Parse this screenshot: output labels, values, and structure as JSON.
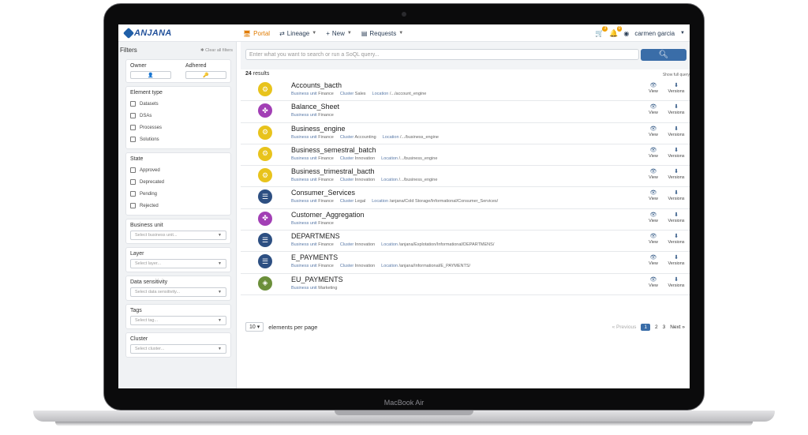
{
  "device": {
    "label": "MacBook Air"
  },
  "nav": {
    "logo_text": "ANJANA",
    "items": [
      {
        "label": "Portal",
        "icon": "monitor-icon",
        "active": true,
        "caret": false
      },
      {
        "label": "Lineage",
        "icon": "lineage-icon",
        "active": false,
        "caret": true
      },
      {
        "label": "New",
        "icon": "plus-icon",
        "active": false,
        "caret": true
      },
      {
        "label": "Requests",
        "icon": "requests-icon",
        "active": false,
        "caret": true
      }
    ],
    "cart_badge": "3",
    "bell_badge": "0",
    "user": "carmen garcia"
  },
  "sidebar": {
    "title": "Filters",
    "clear_label": "Clear all filters",
    "owner_label": "Owner",
    "adhered_label": "Adhered",
    "element_type": {
      "label": "Element type",
      "options": [
        "Datasets",
        "DSAs",
        "Processes",
        "Solutions"
      ]
    },
    "state": {
      "label": "State",
      "options": [
        "Approved",
        "Deprecated",
        "Pending",
        "Rejected"
      ]
    },
    "selects": [
      {
        "label": "Business unit",
        "placeholder": "Select business unit..."
      },
      {
        "label": "Layer",
        "placeholder": "Select layer..."
      },
      {
        "label": "Data sensitivity",
        "placeholder": "Select data sensitivity..."
      },
      {
        "label": "Tags",
        "placeholder": "Select tag..."
      },
      {
        "label": "Cluster",
        "placeholder": "Select cluster..."
      }
    ]
  },
  "search": {
    "placeholder": "Enter what you want to search or run a SoQL query...",
    "results_count": "24",
    "results_label": "results",
    "show_full_query": "Show full query"
  },
  "results": [
    {
      "name": "Accounts_bacth",
      "icon": "process-icon",
      "color": "#e8c31c",
      "meta": [
        [
          "Business unit",
          "Finance"
        ],
        [
          "Cluster",
          "Sales"
        ],
        [
          "Location",
          "/.../account_engine"
        ]
      ]
    },
    {
      "name": "Balance_Sheet",
      "icon": "dsa-icon",
      "color": "#a23fb5",
      "meta": [
        [
          "Business unit",
          "Finance"
        ]
      ]
    },
    {
      "name": "Business_engine",
      "icon": "process-icon",
      "color": "#e8c31c",
      "meta": [
        [
          "Business unit",
          "Finance"
        ],
        [
          "Cluster",
          "Accounting"
        ],
        [
          "Location",
          "/.../business_engine"
        ]
      ]
    },
    {
      "name": "Business_semestral_batch",
      "icon": "process-icon",
      "color": "#e8c31c",
      "meta": [
        [
          "Business unit",
          "Finance"
        ],
        [
          "Cluster",
          "Innovation"
        ],
        [
          "Location",
          "/.../business_engine"
        ]
      ]
    },
    {
      "name": "Business_trimestral_bacth",
      "icon": "process-icon",
      "color": "#e8c31c",
      "meta": [
        [
          "Business unit",
          "Finance"
        ],
        [
          "Cluster",
          "Innovation"
        ],
        [
          "Location",
          "/.../business_engine"
        ]
      ]
    },
    {
      "name": "Consumer_Services",
      "icon": "dataset-icon",
      "color": "#2d4f82",
      "meta": [
        [
          "Business unit",
          "Finance"
        ],
        [
          "Cluster",
          "Legal"
        ],
        [
          "Location",
          "/anjana/Cold Storage/Informational/Consumer_Services/"
        ]
      ]
    },
    {
      "name": "Customer_Aggregation",
      "icon": "dsa-icon",
      "color": "#a23fb5",
      "meta": [
        [
          "Business unit",
          "Finance"
        ]
      ]
    },
    {
      "name": "DEPARTMENS",
      "icon": "dataset-icon",
      "color": "#2d4f82",
      "meta": [
        [
          "Business unit",
          "Finance"
        ],
        [
          "Cluster",
          "Innovation"
        ],
        [
          "Location",
          "/anjana/Explotation/Informational/DEPARTMENS/"
        ]
      ]
    },
    {
      "name": "E_PAYMENTS",
      "icon": "dataset-icon",
      "color": "#2d4f82",
      "meta": [
        [
          "Business unit",
          "Finance"
        ],
        [
          "Cluster",
          "Innovation"
        ],
        [
          "Location",
          "/anjana/Informational/E_PAYMENTS/"
        ]
      ]
    },
    {
      "name": "EU_PAYMENTS",
      "icon": "solution-icon",
      "color": "#6b8f3a",
      "meta": [
        [
          "Business unit",
          "Marketing"
        ]
      ]
    }
  ],
  "row_actions": {
    "view": "View",
    "versions": "Versions"
  },
  "pagination": {
    "per_page_value": "10",
    "per_page_label": "elements per page",
    "previous": "Previous",
    "pages": [
      "1",
      "2",
      "3"
    ],
    "next": "Next"
  }
}
